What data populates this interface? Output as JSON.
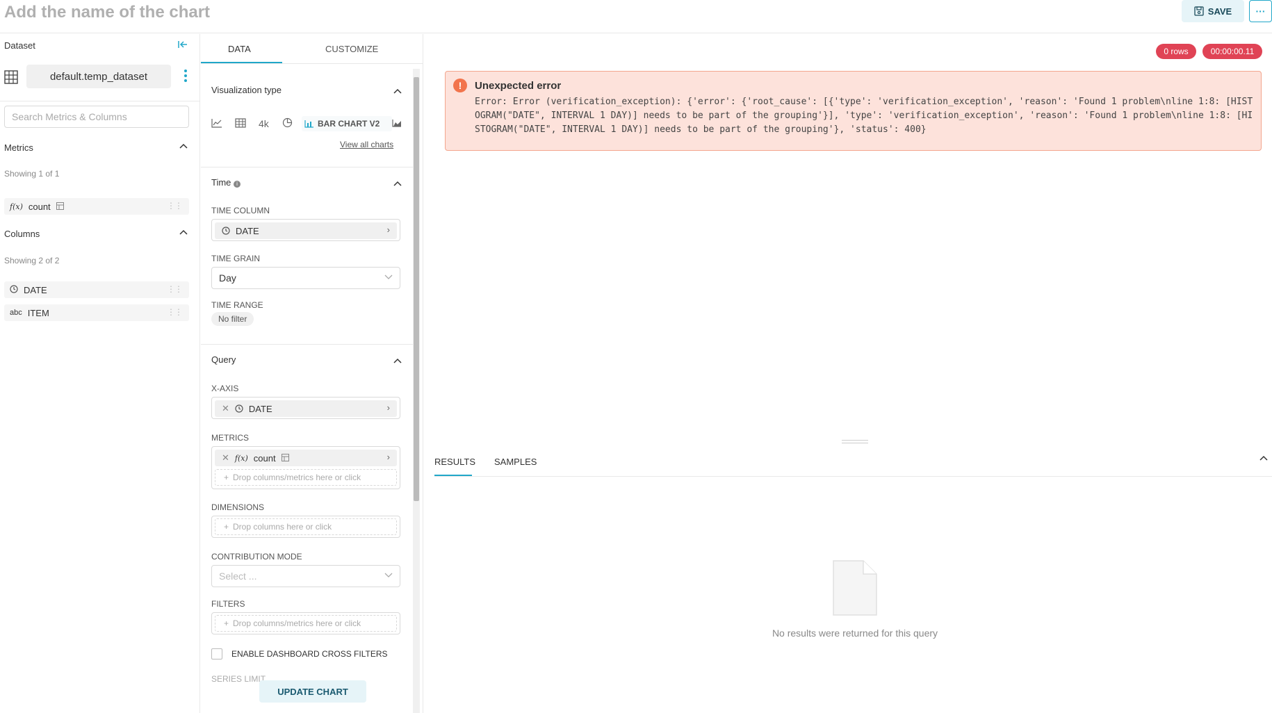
{
  "header": {
    "chart_title_placeholder": "Add the name of the chart",
    "save_label": "SAVE",
    "more_label": "···"
  },
  "dataset_panel": {
    "label": "Dataset",
    "dataset_name": "default.temp_dataset",
    "search_placeholder": "Search Metrics & Columns",
    "metrics": {
      "title": "Metrics",
      "showing": "Showing 1 of 1",
      "items": [
        {
          "type_icon": "f(x)",
          "name": "count"
        }
      ]
    },
    "columns": {
      "title": "Columns",
      "showing": "Showing 2 of 2",
      "items": [
        {
          "type_icon": "clock-icon",
          "name": "DATE"
        },
        {
          "type_icon": "abc",
          "name": "ITEM"
        }
      ]
    }
  },
  "controls": {
    "tabs": [
      "DATA",
      "CUSTOMIZE"
    ],
    "viz_type": {
      "title": "Visualization type",
      "selected": "BAR CHART V2",
      "big_number_label": "4k",
      "view_all": "View all charts"
    },
    "time": {
      "title": "Time",
      "time_column_label": "TIME COLUMN",
      "time_column_value": "DATE",
      "time_grain_label": "TIME GRAIN",
      "time_grain_value": "Day",
      "time_range_label": "TIME RANGE",
      "time_range_value": "No filter"
    },
    "query": {
      "title": "Query",
      "x_axis_label": "X-AXIS",
      "x_axis_value": "DATE",
      "metrics_label": "METRICS",
      "metrics_value": "count",
      "metrics_drop": "Drop columns/metrics here or click",
      "dimensions_label": "DIMENSIONS",
      "dimensions_drop": "Drop columns here or click",
      "contribution_label": "CONTRIBUTION MODE",
      "contribution_placeholder": "Select ...",
      "filters_label": "FILTERS",
      "filters_drop": "Drop columns/metrics here or click",
      "cross_filters_label": "ENABLE DASHBOARD CROSS FILTERS",
      "series_limit_label": "SERIES LIMIT"
    },
    "update_button": "UPDATE CHART"
  },
  "results": {
    "rows_badge": "0 rows",
    "time_badge": "00:00:00.11",
    "error_title": "Unexpected error",
    "error_message": "Error: Error (verification_exception): {'error': {'root_cause': [{'type': 'verification_exception', 'reason': 'Found 1 problem\\nline 1:8: [HISTOGRAM(\"DATE\", INTERVAL 1 DAY)] needs to be part of the grouping'}], 'type': 'verification_exception', 'reason': 'Found 1 problem\\nline 1:8: [HISTOGRAM(\"DATE\", INTERVAL 1 DAY)] needs to be part of the grouping'}, 'status': 400}",
    "tabs": [
      "RESULTS",
      "SAMPLES"
    ],
    "empty_message": "No results were returned for this query"
  },
  "colors": {
    "accent": "#20a7c9",
    "error_bg": "#fde2db",
    "error_border": "#f3a68e",
    "badge": "#e04355"
  }
}
